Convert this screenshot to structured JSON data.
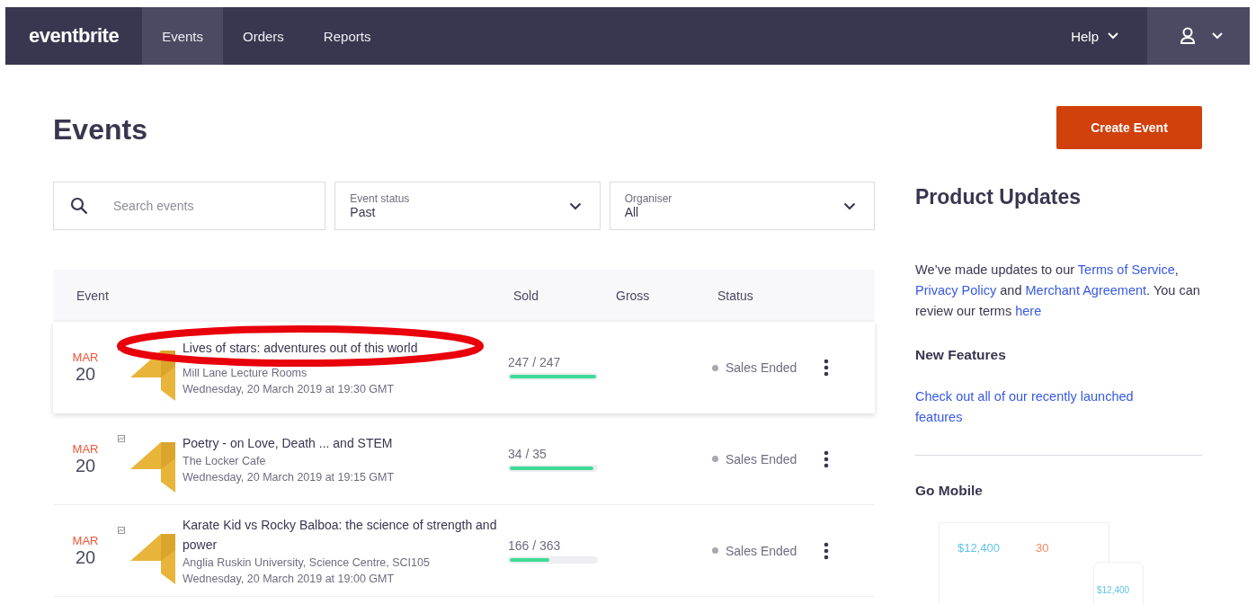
{
  "nav": {
    "logo": "eventbrite",
    "tabs": [
      {
        "label": "Events",
        "selected": true
      },
      {
        "label": "Orders",
        "selected": false
      },
      {
        "label": "Reports",
        "selected": false
      }
    ],
    "help": "Help"
  },
  "page": {
    "title": "Events",
    "create_button": "Create Event"
  },
  "filters": {
    "search": {
      "placeholder": "Search events"
    },
    "status": {
      "label": "Event status",
      "value": "Past"
    },
    "organiser": {
      "label": "Organiser",
      "value": "All"
    }
  },
  "table": {
    "columns": [
      "Event",
      "Sold",
      "Gross",
      "Status"
    ],
    "rows": [
      {
        "month": "MAR",
        "day": "20",
        "title": "Lives of stars: adventures out of this world",
        "venue": "Mill Lane Lecture Rooms",
        "date": "Wednesday, 20 March 2019 at 19:30 GMT",
        "sold": "247 / 247",
        "level": 1,
        "status": "Sales Ended",
        "selected": true
      },
      {
        "month": "MAR",
        "day": "20",
        "title": "Poetry - on Love, Death ... and STEM",
        "venue": "The Locker Cafe",
        "date": "Wednesday, 20 March 2019 at 19:15 GMT",
        "sold": "34 / 35",
        "level": 0.97,
        "status": "Sales Ended",
        "selected": false
      },
      {
        "month": "MAR",
        "day": "20",
        "title": "Karate Kid vs Rocky Balboa: the science of strength and power",
        "venue": "Anglia Ruskin University, Science Centre, SCI105",
        "date": "Wednesday, 20 March 2019 at 19:00 GMT",
        "sold": "166 / 363",
        "level": 0.457,
        "status": "Sales Ended",
        "selected": false
      }
    ]
  },
  "sidebar": {
    "title": "Product Updates",
    "updates": [
      {
        "kind": "text",
        "text": "We’ve made updates to our "
      },
      {
        "kind": "link",
        "text": "Terms of Service"
      },
      {
        "kind": "text",
        "text": ", "
      },
      {
        "kind": "link",
        "text": "Privacy Policy"
      },
      {
        "kind": "text",
        "text": " and "
      },
      {
        "kind": "link",
        "text": "Merchant Agreement"
      },
      {
        "kind": "text",
        "text": ". You can review our terms "
      },
      {
        "kind": "link",
        "text": "here"
      }
    ],
    "features_title": "New Features",
    "features_link": "Check out all of our recently launched features",
    "mobile_title": "Go Mobile",
    "mobile_preview": {
      "tablet_sales": "$12,400",
      "tablet_count": "30",
      "phone_sales": "$12,400"
    }
  },
  "annotation": {
    "kind": "ellipse",
    "color": "#e8000b"
  }
}
